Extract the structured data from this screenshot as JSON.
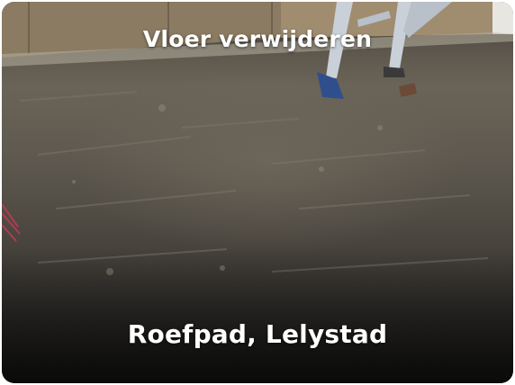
{
  "photo": {
    "subject": "concrete-floor-after-removal",
    "colors": {
      "wall": "#8a7a63",
      "floor": "#5f5a50",
      "ladder": "#cfd6de",
      "ladder_feet": "#2e4f8a"
    }
  },
  "captions": {
    "title": "Vloer verwijderen",
    "location": "Roefpad, Lelystad"
  }
}
